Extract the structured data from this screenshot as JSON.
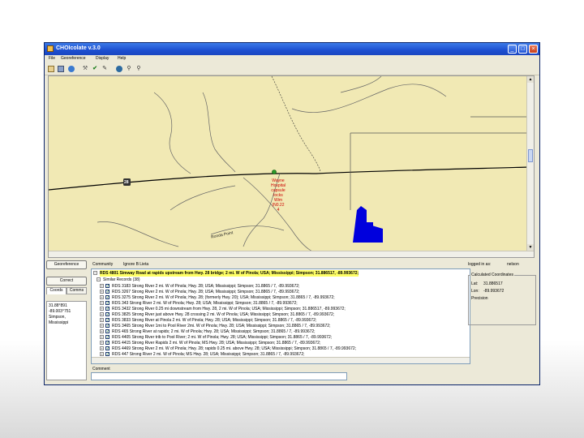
{
  "window": {
    "title": "CHOIcolate v.3.0"
  },
  "menu": [
    "File",
    "Georeference",
    "Display",
    "Help"
  ],
  "toolbar_icons": [
    "open-icon",
    "save-icon",
    "globe-icon",
    "tool-icon",
    "green-check-icon",
    "edit-icon",
    "info-icon",
    "zoom-in-icon",
    "zoom-out-icon"
  ],
  "map": {
    "badge_label": "28",
    "marker_text": [
      "Wayne",
      "Hospital",
      "capsule",
      "locks",
      "Wim",
      "(N0.22",
      "4"
    ],
    "road_label": "Ronda Point"
  },
  "left_panel": {
    "georeference_button": "Georeference",
    "correct_button": "Correct",
    "tabs": [
      "Coords",
      "Comms"
    ],
    "coords": [
      "31.88°891",
      "-89.003°751",
      "Simpson,",
      "Mississippi"
    ]
  },
  "middle_panel": {
    "community_label": "Community",
    "community_value": "Ignore B Lieta",
    "header_row": "RDS 4801 Simway Road at rapids upstream from Hwy. 28 bridge; 2 mi. W of Pinola; USA; Mississippi; Simpson; 31.886517, -89.993672;",
    "sub_header": "Similar Records (38)",
    "rows": [
      "RDS 3183 Strong River 2 mi. W of Pinola; Hwy. 28; USA; Mississippi; Simpson; 31.8865 / 7, -89.993672;",
      "RDS 3267 Strong River 2 mi. W of Pinola; Hwy. 28; USA; Mississippi; Simpson; 31.8865 / 7, -89.993672;",
      "RDS 3275 Strong River 2 mi. W of Pinola; Hwy. 28; (formerly Hwy. 20); USA; Mississippi; Simpson; 31.8865 / 7, -89.993672;",
      "RDS 343 Strong River 2 mi. W of Pinola; Hwy. 28; USA; Mississippi; Simpson; 31.8865 / 7, -89.993672;",
      "RDS 3432 Strong River 0.25 mi downstream from Hwy. 28, 2 mi. W of Pinola; USA; Mississippi; Simpson; 31.886517, -89.993672;",
      "RDS 3825 Strong River just above Hwy. 28 crossing 2 mi. W of Pinola; USA; Mississippi; Simpson; 31.8865 / 7, -89.993672;",
      "RDS 3833 Strong River at Pinola 2 mi. W of Pinola; Hwy. 28; USA; Mississippi; Simpson; 31.8865 / 7, -89.993672;",
      "RDS 3465 Strong River 1mi to Pool River 2mi. W of Pinola; Hwy. 28; USA; Mississippi; Simpson; 31.8865 / 7, -89.993672;",
      "RDS 465 Strong River at rapids; 2 mi. W of Pinola; Hwy. 28; USA; Mississippi; Simpson; 31.8865 / 7, -89.993672;",
      "RDS 4405 Strong River trib to Pool River; 2 mi. W of Pinola; Hwy. 28; USA; Mississippi; Simpson; 31.8865 / 7, -89.993672;",
      "RDS 4415 Strong River Rapids 2 mi. W of Pinola; MS Hwy. 28; USA; Mississippi; Simpson; 31.8865 / 7, -89.993672;",
      "RDS 4469 Strong River 2 mi. W of Pinola; Hwy. 28; rapids 0.25 mi. above Hwy. 28; USA; Mississippi; Simpson; 31.8865 / 7, -89.993672;",
      "RDS 447 Strong River 2 mi. W of Pinola; MS Hwy. 28; USA; Mississippi; Simpson; 31.8865 / 7, -89.993672;",
      "RDS 449 Strong River 2 mi. W of Pinola; MS Hwy. 28; USA; Mississippi; Simpson; 31.886517, -89.993672;"
    ],
    "comment_label": "Comment"
  },
  "right_panel": {
    "logged_in_label": "logged in as:",
    "logged_in_user": "nelson",
    "group_title": "Calculated Coordinates",
    "lat_label": "Lat:",
    "lat_value": "31.886517",
    "lon_label": "Lon:",
    "lon_value": "-89.993672",
    "precision_label": "Precision"
  }
}
